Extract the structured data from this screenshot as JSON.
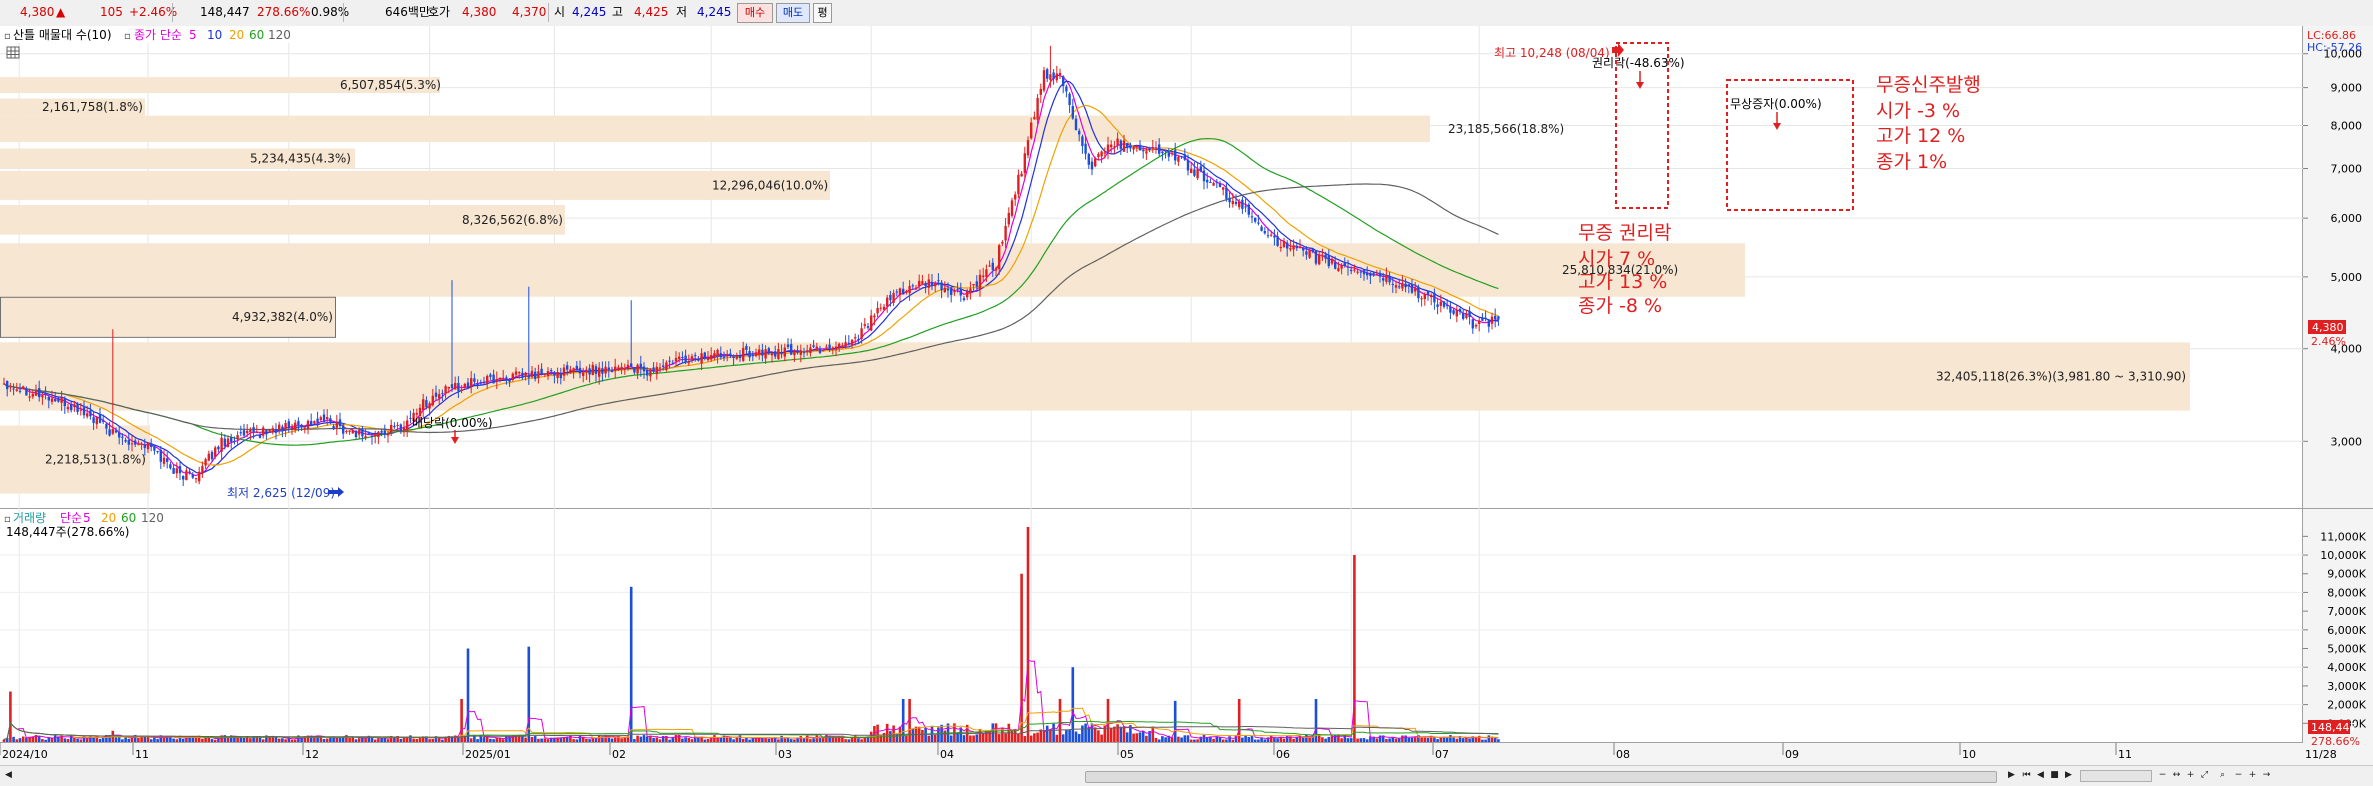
{
  "quote": {
    "price": "4,380",
    "arrow": "▲",
    "change": "105",
    "change_pct": "+2.46%",
    "volume": "148,447",
    "volume_pct": "278.66%",
    "turnover_pct": "0.98%",
    "amount": "646백만",
    "hoga_label": "호가",
    "ask": "4,380",
    "bid": "4,370",
    "open_label": "시",
    "open": "4,245",
    "high_label": "고",
    "high": "4,425",
    "low_label": "저",
    "low": "4,245"
  },
  "buttons": {
    "buy": "매수",
    "sell": "매도",
    "extra": "평"
  },
  "price_panel": {
    "title": "산틀 매물대 수(10)",
    "ma_label": "종가 단순",
    "ma_periods": [
      "5",
      "10",
      "20",
      "60",
      "120"
    ],
    "ma_colors": [
      "#e000e0",
      "#2030e0",
      "#f0a000",
      "#20a020",
      "#606060"
    ],
    "lc_label": "LC:66.86",
    "hc_label": "HC:-57.26",
    "last_price_tag": "4,380",
    "last_pct_tag": "2.46%"
  },
  "volume_panel": {
    "title": "거래량",
    "ma_label": "단순",
    "ma_periods": [
      "5",
      "20",
      "60",
      "120"
    ],
    "current": "148,447주(278.66%)",
    "last_tag": "148,447",
    "last_pct_tag": "278.66%"
  },
  "y_axis_labels": [
    "10,000",
    "9,000",
    "8,000",
    "7,000",
    "6,000",
    "5,000",
    "4,000",
    "3,000"
  ],
  "vol_axis_labels": [
    "11,000K",
    "10,000K",
    "9,000K",
    "8,000K",
    "7,000K",
    "6,000K",
    "5,000K",
    "4,000K",
    "3,000K",
    "2,000K",
    "1,000K"
  ],
  "x_axis_labels": [
    "2024/10",
    "11",
    "12",
    "2025/01",
    "02",
    "03",
    "04",
    "05",
    "06",
    "07",
    "08",
    "09",
    "10",
    "11",
    "11/28"
  ],
  "volume_profile": [
    "6,507,854(5.3%)",
    "2,161,758(1.8%)",
    "23,185,566(18.8%)",
    "5,234,435(4.3%)",
    "12,296,046(10.0%)",
    "8,326,562(6.8%)",
    "25,810,834(21.0%)",
    "4,932,382(4.0%)",
    "32,405,118(26.3%)(3,981.80 ~ 3,310.90)",
    "2,218,513(1.8%)"
  ],
  "annotations": {
    "high_marker": "최고 10,248 (08/04)",
    "low_marker": "최저 2,625 (12/09)",
    "dividend": "배당락(0.00%)",
    "rights_drop": "권리락(-48.63%)",
    "bonus_issue": "무상증자(0.00%)",
    "note1_title": "무증 권리락",
    "note1_lines": [
      "시가  7 %",
      "고가 13 %",
      "종가 -8 %"
    ],
    "note2_title": "무증신주발행",
    "note2_lines": [
      "시가 -3 %",
      "고가 12 %",
      "종가   1%"
    ]
  },
  "ui_colors": {
    "up": "#e02020",
    "down": "#1c4fd8",
    "profile": "#f7e6d2",
    "annotation": "#e02020"
  },
  "chart_data": {
    "type": "candlestick",
    "period_start": "2024/10",
    "period_end": "11/28",
    "price_scale": "log",
    "price_range": [
      2500,
      10500
    ],
    "anchors": [
      [
        0,
        3600
      ],
      [
        13,
        3450
      ],
      [
        24,
        3300
      ],
      [
        35,
        3050
      ],
      [
        45,
        2960
      ],
      [
        55,
        2700
      ],
      [
        61,
        2720
      ],
      [
        68,
        3000
      ],
      [
        80,
        3080
      ],
      [
        90,
        3150
      ],
      [
        100,
        3200
      ],
      [
        108,
        3100
      ],
      [
        115,
        3050
      ],
      [
        125,
        3150
      ],
      [
        130,
        3350
      ],
      [
        140,
        3550
      ],
      [
        155,
        3650
      ],
      [
        170,
        3700
      ],
      [
        185,
        3750
      ],
      [
        195,
        3800
      ],
      [
        200,
        3700
      ],
      [
        210,
        3850
      ],
      [
        225,
        3950
      ],
      [
        240,
        3950
      ],
      [
        255,
        4000
      ],
      [
        265,
        4100
      ],
      [
        280,
        4800
      ],
      [
        290,
        4900
      ],
      [
        300,
        4700
      ],
      [
        310,
        5200
      ],
      [
        318,
        7000
      ],
      [
        325,
        9200
      ],
      [
        330,
        9400
      ],
      [
        336,
        7700
      ],
      [
        340,
        7000
      ],
      [
        345,
        7600
      ],
      [
        355,
        7500
      ],
      [
        365,
        7300
      ],
      [
        375,
        6800
      ],
      [
        385,
        6300
      ],
      [
        390,
        6000
      ],
      [
        400,
        5500
      ],
      [
        415,
        5200
      ],
      [
        430,
        5000
      ],
      [
        445,
        4700
      ],
      [
        460,
        4300
      ],
      [
        467,
        4380
      ]
    ],
    "peak": 10248,
    "trough": 2625,
    "volume_scale_max": 11500,
    "volume_spikes": [
      [
        2,
        2700
      ],
      [
        34,
        600
      ],
      [
        143,
        2300
      ],
      [
        145,
        5000
      ],
      [
        164,
        5100
      ],
      [
        196,
        8300
      ],
      [
        281,
        2300
      ],
      [
        283,
        2300
      ],
      [
        318,
        9000
      ],
      [
        320,
        11500
      ],
      [
        330,
        2300
      ],
      [
        334,
        4000
      ],
      [
        345,
        2300
      ],
      [
        366,
        2200
      ],
      [
        386,
        2300
      ],
      [
        410,
        2300
      ],
      [
        422,
        10000
      ],
      [
        467,
        148
      ]
    ]
  }
}
